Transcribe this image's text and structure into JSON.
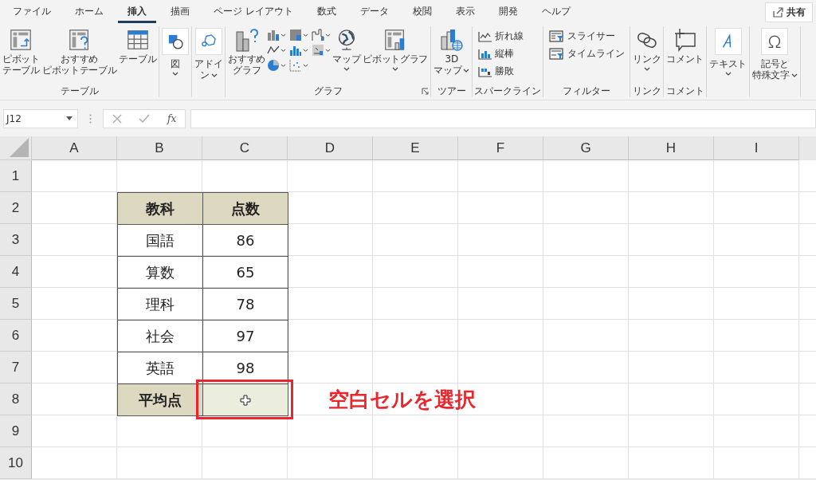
{
  "menu_tabs": [
    {
      "label": "ファイル",
      "selected": false
    },
    {
      "label": "ホーム",
      "selected": false
    },
    {
      "label": "挿入",
      "selected": true
    },
    {
      "label": "描画",
      "selected": false
    },
    {
      "label": "ページ レイアウト",
      "selected": false
    },
    {
      "label": "数式",
      "selected": false
    },
    {
      "label": "データ",
      "selected": false
    },
    {
      "label": "校閲",
      "selected": false
    },
    {
      "label": "表示",
      "selected": false
    },
    {
      "label": "開発",
      "selected": false
    },
    {
      "label": "ヘルプ",
      "selected": false
    }
  ],
  "share_button": {
    "label": "共有"
  },
  "ribbon_groups": [
    {
      "label": "テーブル",
      "items": [
        {
          "kind": "large",
          "label_lines": [
            "ピボット",
            "テーブル"
          ]
        },
        {
          "kind": "large",
          "label_lines": [
            "おすすめ",
            "ピボットテーブル"
          ]
        },
        {
          "kind": "large",
          "label_lines": [
            "テーブル"
          ]
        }
      ]
    },
    {
      "items": [
        {
          "kind": "boxed",
          "label_lines": [
            "図"
          ],
          "dropdown": true
        }
      ]
    },
    {
      "items": [
        {
          "kind": "boxed",
          "label_lines": [
            "アドイ",
            "ン"
          ],
          "dropdown": true
        }
      ]
    },
    {
      "label": "グラフ",
      "launcher": true,
      "items": [
        {
          "kind": "large",
          "label_lines": [
            "おすすめ",
            "グラフ"
          ]
        },
        {
          "kind": "chart-grid"
        },
        {
          "kind": "large",
          "label_lines": [
            "マップ"
          ],
          "dropdown": true
        },
        {
          "kind": "large",
          "label_lines": [
            "ピボットグラフ"
          ],
          "dropdown": true
        }
      ]
    },
    {
      "label": "ツアー",
      "items": [
        {
          "kind": "large",
          "label_lines": [
            "3D",
            "マップ"
          ],
          "dropdown": true
        }
      ]
    },
    {
      "label": "スパークライン",
      "items": [
        {
          "kind": "small",
          "label_lines": [
            "折れ線"
          ]
        },
        {
          "kind": "small",
          "label_lines": [
            "縦棒"
          ]
        },
        {
          "kind": "small",
          "label_lines": [
            "勝敗"
          ]
        }
      ]
    },
    {
      "label": "フィルター",
      "items": [
        {
          "kind": "small",
          "label_lines": [
            "スライサー"
          ]
        },
        {
          "kind": "small",
          "label_lines": [
            "タイムライン"
          ]
        }
      ]
    },
    {
      "label": "リンク",
      "items": [
        {
          "kind": "large",
          "label_lines": [
            "リンク"
          ],
          "dropdown": true
        }
      ]
    },
    {
      "label": "コメント",
      "items": [
        {
          "kind": "large",
          "label_lines": [
            "コメント"
          ]
        }
      ]
    },
    {
      "items": [
        {
          "kind": "boxed",
          "label_lines": [
            "テキスト"
          ],
          "dropdown": true
        }
      ]
    },
    {
      "items": [
        {
          "kind": "boxed",
          "label_lines": [
            "記号と",
            "特殊文字"
          ],
          "dropdown": true
        }
      ]
    }
  ],
  "name_box": {
    "value": "J12"
  },
  "formula_bar": {
    "fx_label": "fx"
  },
  "sheet": {
    "columns": [
      "A",
      "B",
      "C",
      "D",
      "E",
      "F",
      "G",
      "H",
      "I"
    ],
    "rows": [
      "1",
      "2",
      "3",
      "4",
      "5",
      "6",
      "7",
      "8",
      "9",
      "10"
    ],
    "table": {
      "header": [
        "教科",
        "点数"
      ],
      "rows": [
        {
          "subject": "国語",
          "score": "86"
        },
        {
          "subject": "算数",
          "score": "65"
        },
        {
          "subject": "理科",
          "score": "78"
        },
        {
          "subject": "社会",
          "score": "97"
        },
        {
          "subject": "英語",
          "score": "98"
        }
      ],
      "footer": {
        "label": "平均点",
        "selected": true
      }
    }
  },
  "annotation": {
    "text": "空白セルを選択"
  }
}
